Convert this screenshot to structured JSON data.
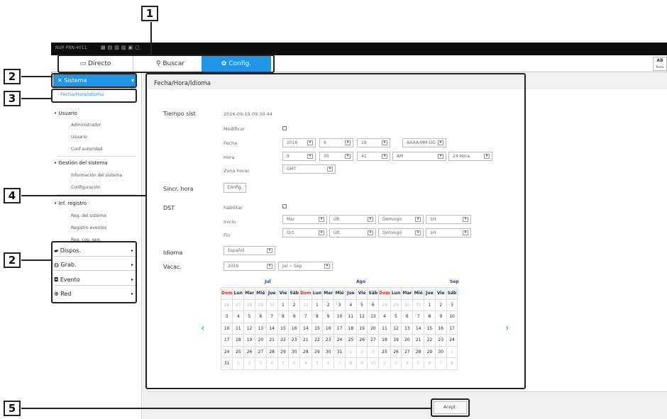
{
  "callouts": [
    "1",
    "2",
    "3",
    "4",
    "2",
    "5"
  ],
  "header": {
    "title": "NVR PRN-4011",
    "ab": "AB",
    "texto": "Texto"
  },
  "tabs": [
    {
      "label": "Directo",
      "icon": "monitor-icon"
    },
    {
      "label": "Buscar",
      "icon": "search-icon"
    },
    {
      "label": "Config.",
      "icon": "gear-icon",
      "active": true
    }
  ],
  "sidebar": {
    "header": "Sistema",
    "active_item": "Fecha/Hora/Idioma",
    "groups": [
      {
        "label": "Usuario",
        "items": [
          "Administrador",
          "Usuario",
          "Conf autoridad"
        ]
      },
      {
        "label": "Gestión del sistema",
        "items": [
          "Información del sistema",
          "Configuración"
        ]
      },
      {
        "label": "Inf. registro",
        "items": [
          "Reg. del sistema",
          "Registro eventos",
          "Reg. cop. seg."
        ]
      }
    ],
    "menus": [
      {
        "label": "Dispos.",
        "icon": "device-icon"
      },
      {
        "label": "Grab.",
        "icon": "record-icon"
      },
      {
        "label": "Evento",
        "icon": "event-icon"
      },
      {
        "label": "Red",
        "icon": "network-icon"
      }
    ]
  },
  "panel": {
    "title": "Fecha/Hora/Idioma",
    "tiempo": {
      "label": "Tiempo sist",
      "value": "2016-09-19 09:30:44",
      "modificar": "Modificar",
      "fecha_label": "Fecha",
      "fecha": [
        "2016",
        "9",
        "19",
        "AAAA-MM-DD"
      ],
      "hora_label": "Hora",
      "hora": [
        "9",
        "30",
        "41",
        "AM",
        "24 Hora"
      ],
      "zona_label": "Zona horar.",
      "zona": "GMT"
    },
    "sincr": {
      "label": "Sincr. hora",
      "button": "Config."
    },
    "dst": {
      "label": "DST",
      "habilitar": "habilitar",
      "inicio_label": "Inicio",
      "inicio": [
        "Mar",
        "Últ.",
        "Domingo",
        "1H"
      ],
      "fin_label": "Fin",
      "fin": [
        "Oct",
        "Últ.",
        "Domingo",
        "1H"
      ]
    },
    "idioma": {
      "label": "Idioma",
      "value": "Español"
    },
    "vacac": {
      "label": "Vacac.",
      "year": "2016",
      "range": "Jul ~ Sep"
    },
    "calendar": {
      "months": [
        "Jul",
        "Ago",
        "Sep"
      ],
      "weekdays": [
        "Dom",
        "Lun",
        "Mar",
        "Mié",
        "Jue",
        "Vie",
        "Sáb"
      ],
      "rows": [
        [
          "26",
          "27",
          "28",
          "29",
          "30",
          "1",
          "2",
          "31",
          "1",
          "2",
          "3",
          "4",
          "5",
          "6",
          "28",
          "29",
          "30",
          "31",
          "1",
          "2",
          "3"
        ],
        [
          "3",
          "4",
          "5",
          "6",
          "7",
          "8",
          "9",
          "7",
          "8",
          "9",
          "10",
          "11",
          "12",
          "13",
          "4",
          "5",
          "6",
          "7",
          "8",
          "9",
          "10"
        ],
        [
          "10",
          "11",
          "12",
          "13",
          "14",
          "15",
          "16",
          "14",
          "15",
          "16",
          "17",
          "18",
          "19",
          "20",
          "11",
          "12",
          "13",
          "14",
          "15",
          "16",
          "17"
        ],
        [
          "17",
          "18",
          "19",
          "20",
          "21",
          "22",
          "23",
          "21",
          "22",
          "23",
          "24",
          "25",
          "26",
          "27",
          "18",
          "19",
          "20",
          "21",
          "22",
          "23",
          "24"
        ],
        [
          "24",
          "25",
          "26",
          "27",
          "28",
          "29",
          "30",
          "28",
          "29",
          "30",
          "31",
          "1",
          "2",
          "3",
          "25",
          "26",
          "27",
          "28",
          "29",
          "30",
          "1"
        ],
        [
          "31",
          "1",
          "2",
          "3",
          "4",
          "5",
          "6",
          "4",
          "5",
          "6",
          "7",
          "8",
          "9",
          "10",
          "2",
          "3",
          "4",
          "5",
          "6",
          "7",
          "8"
        ]
      ],
      "prev": "‹",
      "next": "›"
    },
    "accept": "Acept."
  }
}
